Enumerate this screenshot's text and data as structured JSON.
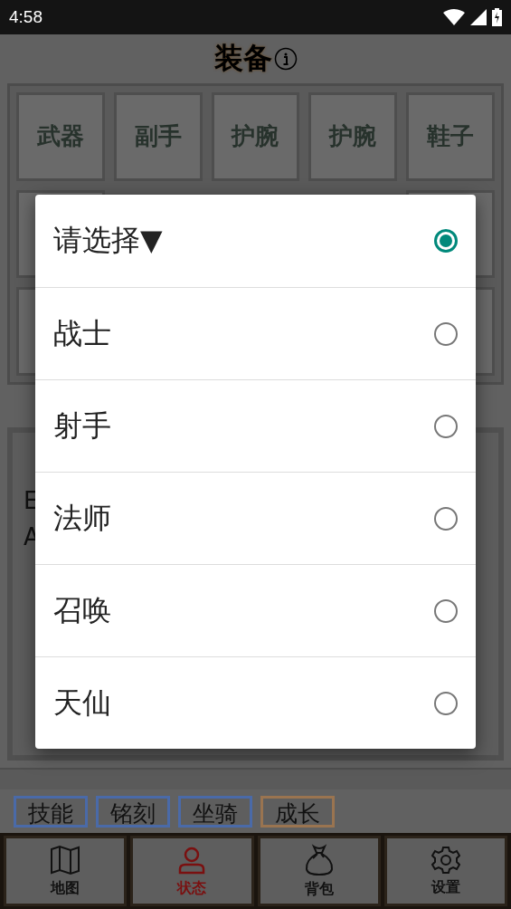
{
  "status_bar": {
    "time": "4:58"
  },
  "title": "装备",
  "equipment_slots": [
    "武器",
    "副手",
    "护腕",
    "护腕",
    "鞋子"
  ],
  "stats_lines": [
    "E",
    "A"
  ],
  "tabs": [
    {
      "label": "技能",
      "color": "#4a6aa8"
    },
    {
      "label": "铭刻",
      "color": "#4a6aa8"
    },
    {
      "label": "坐骑",
      "color": "#4a6aa8"
    },
    {
      "label": "成长",
      "color": "#9a7450"
    }
  ],
  "nav": [
    {
      "label": "地图",
      "kind": "map",
      "selected": false
    },
    {
      "label": "状态",
      "kind": "person",
      "selected": true
    },
    {
      "label": "背包",
      "kind": "bag",
      "selected": false
    },
    {
      "label": "设置",
      "kind": "settings",
      "selected": false
    }
  ],
  "dialog": {
    "options": [
      {
        "label": "请选择▼",
        "selected": true
      },
      {
        "label": "战士",
        "selected": false
      },
      {
        "label": "射手",
        "selected": false
      },
      {
        "label": "法师",
        "selected": false
      },
      {
        "label": "召唤",
        "selected": false
      },
      {
        "label": "天仙",
        "selected": false
      }
    ]
  }
}
